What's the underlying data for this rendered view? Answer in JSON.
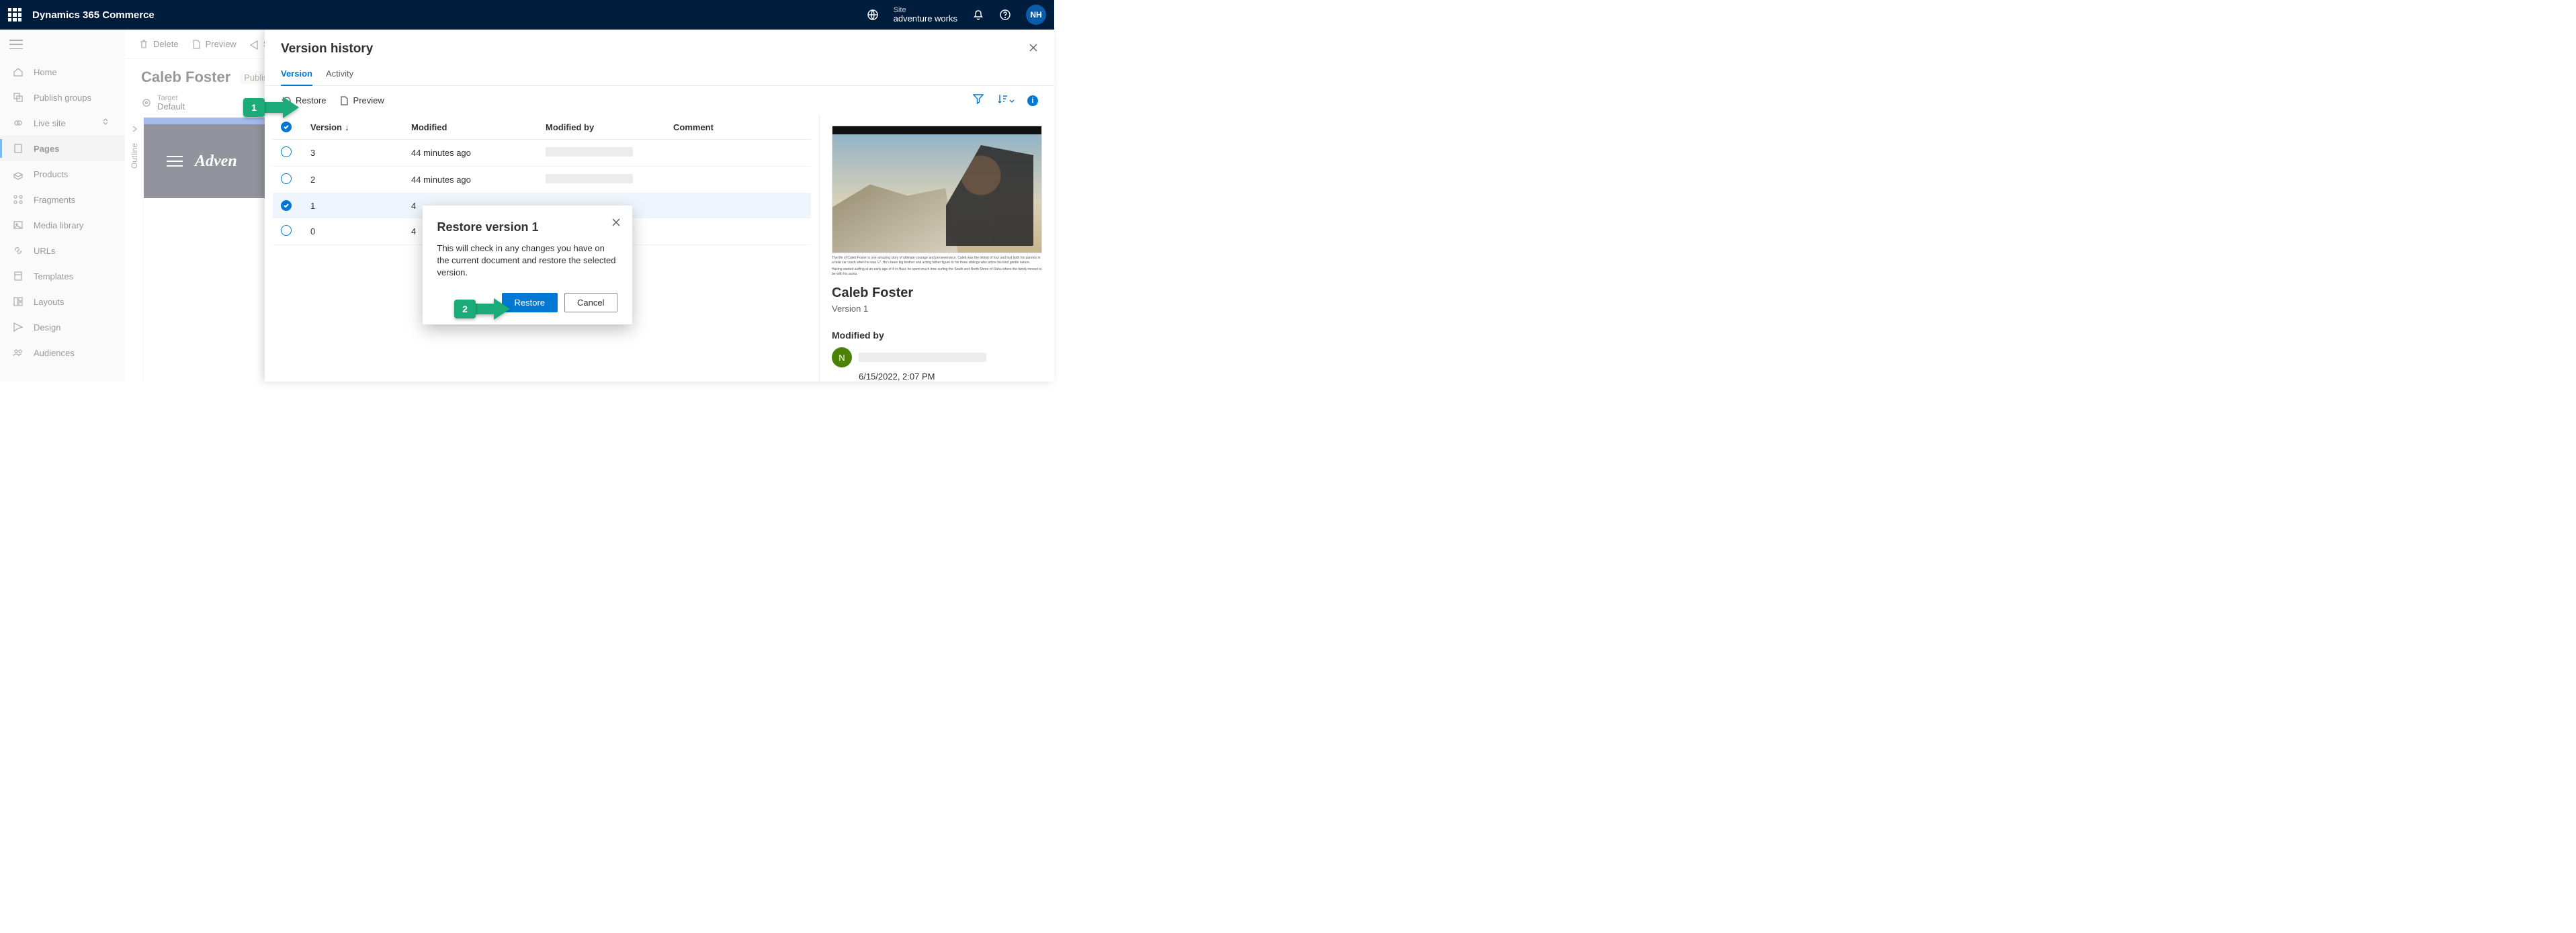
{
  "topnav": {
    "brand": "Dynamics 365 Commerce",
    "siteLabel": "Site",
    "siteName": "adventure works",
    "avatar": "NH"
  },
  "leftnav": {
    "items": [
      "Home",
      "Publish groups",
      "Live site",
      "Pages",
      "Products",
      "Fragments",
      "Media library",
      "URLs",
      "Templates",
      "Layouts",
      "Design",
      "Audiences"
    ]
  },
  "toolbar": {
    "delete": "Delete",
    "preview": "Preview",
    "share": "S"
  },
  "page": {
    "title": "Caleb Foster",
    "status": "Published,",
    "targetLabel": "Target",
    "targetValue": "Default",
    "outline": "Outline",
    "previewBrand": "Adven"
  },
  "panel": {
    "title": "Version history",
    "tabs": {
      "version": "Version",
      "activity": "Activity"
    },
    "actions": {
      "restore": "Restore",
      "preview": "Preview"
    },
    "table": {
      "headers": {
        "version": "Version",
        "modified": "Modified",
        "modifiedBy": "Modified by",
        "comment": "Comment"
      },
      "rows": [
        {
          "v": "3",
          "mod": "44 minutes ago",
          "sel": false
        },
        {
          "v": "2",
          "mod": "44 minutes ago",
          "sel": false
        },
        {
          "v": "1",
          "mod": "4",
          "sel": true
        },
        {
          "v": "0",
          "mod": "4",
          "sel": false
        }
      ]
    },
    "side": {
      "title": "Caleb Foster",
      "vnum": "Version 1",
      "modLabel": "Modified by",
      "modAvatar": "N",
      "modTs": "6/15/2022, 2:07 PM",
      "blurb1": "The life of Caleb Foster is one amazing story of ultimate courage and perseverance. Caleb was the oldest of four and lost both his parents in a fatal car crash when he was 17. He's been big brother and acting father figure to his three siblings who adore his kind gentle nature.",
      "blurb2": "Having started surfing at an early age of 4 in Haui; he spent much time surfing the South and North Shore of Oahu where the family moved to be with his aunts."
    }
  },
  "modal": {
    "title": "Restore version 1",
    "body": "This will check in any changes you have on the current document and restore the selected version.",
    "restore": "Restore",
    "cancel": "Cancel"
  },
  "arrows": {
    "one": "1",
    "two": "2"
  }
}
